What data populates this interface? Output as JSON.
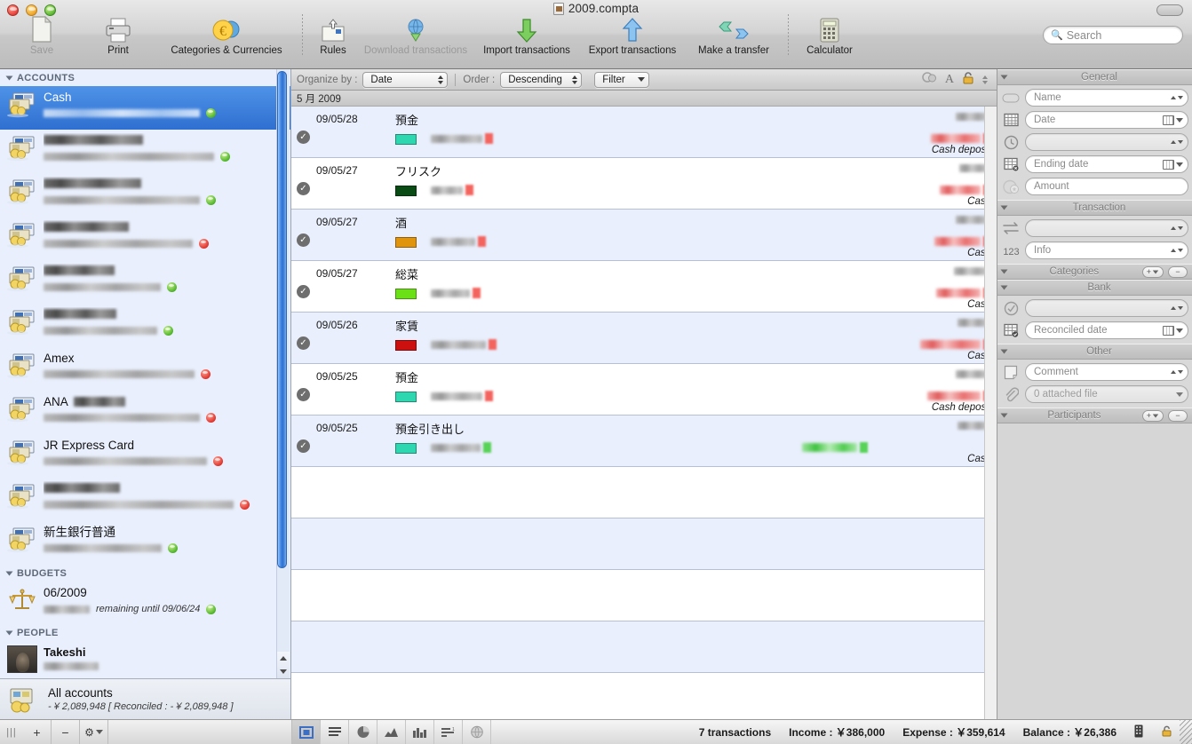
{
  "window": {
    "title": "2009.compta"
  },
  "toolbar": {
    "items": [
      {
        "label": "Save",
        "icon": "document-icon",
        "dim": true
      },
      {
        "label": "Print",
        "icon": "printer-icon",
        "dim": false
      },
      {
        "label": "Categories & Currencies",
        "icon": "euro-coin-icon",
        "dim": false
      },
      {
        "label": "Rules",
        "icon": "rules-icon",
        "dim": false
      },
      {
        "label": "Download transactions",
        "icon": "globe-download-icon",
        "dim": true
      },
      {
        "label": "Import transactions",
        "icon": "green-down-arrow-icon",
        "dim": false
      },
      {
        "label": "Export transactions",
        "icon": "blue-up-arrow-icon",
        "dim": false
      },
      {
        "label": "Make a transfer",
        "icon": "transfer-arrows-icon",
        "dim": false
      },
      {
        "label": "Calculator",
        "icon": "calculator-icon",
        "dim": false
      }
    ],
    "search": {
      "placeholder": "Search",
      "icon": "search-icon"
    }
  },
  "sidebar": {
    "groups": {
      "accounts_label": "ACCOUNTS",
      "budgets_label": "BUDGETS",
      "people_label": "PEOPLE"
    },
    "accounts": [
      {
        "name": "Cash",
        "name_redacted": false,
        "name_blur_w": 0,
        "sub_blur_w": 176,
        "status": "green",
        "selected": true
      },
      {
        "name": "",
        "name_redacted": true,
        "name_blur_w": 112,
        "sub_blur_w": 192,
        "status": "green",
        "selected": false
      },
      {
        "name": "",
        "name_redacted": true,
        "name_blur_w": 110,
        "sub_blur_w": 176,
        "status": "green",
        "selected": false
      },
      {
        "name": "",
        "name_redacted": true,
        "name_blur_w": 96,
        "sub_blur_w": 168,
        "status": "red",
        "selected": false
      },
      {
        "name": "",
        "name_redacted": true,
        "name_blur_w": 80,
        "sub_blur_w": 132,
        "status": "green",
        "selected": false
      },
      {
        "name": "",
        "name_redacted": true,
        "name_blur_w": 82,
        "sub_blur_w": 128,
        "status": "green",
        "selected": false
      },
      {
        "name": "Amex",
        "name_redacted": false,
        "name_blur_w": 0,
        "sub_blur_w": 170,
        "status": "red",
        "selected": false
      },
      {
        "name": "ANA",
        "name_redacted": false,
        "name_blur_w": 58,
        "sub_blur_w": 176,
        "status": "red",
        "selected": false
      },
      {
        "name": "JR Express Card",
        "name_redacted": false,
        "name_blur_w": 0,
        "sub_blur_w": 184,
        "status": "red",
        "selected": false
      },
      {
        "name": "",
        "name_redacted": true,
        "name_blur_w": 86,
        "sub_blur_w": 214,
        "status": "red",
        "selected": false
      },
      {
        "name": "新生銀行普通",
        "name_redacted": false,
        "name_blur_w": 0,
        "sub_blur_w": 133,
        "status": "green",
        "selected": false
      }
    ],
    "budget": {
      "name": "06/2009",
      "remaining_blur_w": 52,
      "sub_text": "remaining until 09/06/24",
      "status": "green",
      "icon": "scales-icon"
    },
    "person": {
      "name": "Takeshi",
      "sub_blur_w": 62,
      "icon": "avatar"
    },
    "footer": {
      "name": "All accounts",
      "sub": "- ¥ 2,089,948 [ Reconciled : - ¥ 2,089,948 ]",
      "icon": "all-accounts-icon"
    },
    "footer_buttons": [
      {
        "icon": "plus-icon",
        "label": "+"
      },
      {
        "icon": "minus-icon",
        "label": "−"
      },
      {
        "icon": "gear-icon",
        "label": "⚙"
      }
    ]
  },
  "transactions_header": {
    "organize_label": "Organize by :",
    "organize_value": "Date",
    "order_label": "Order :",
    "order_value": "Descending",
    "filter_label": "Filter",
    "right_icons": [
      "currency-icon",
      "font-size-icon",
      "lock-icon"
    ]
  },
  "month_group": "5 月 2009",
  "transactions": [
    {
      "date": "09/05/28",
      "category": "預金",
      "color": "#2fd7b0",
      "reconciled": true,
      "mid_blur_w": 58,
      "amt_top_blur_w": 40,
      "amt_mid_blur_w": 56,
      "amt_sign": "red",
      "green_amount": false,
      "account": "Cash deposit",
      "stripe": "even"
    },
    {
      "date": "09/05/27",
      "category": "フリスク",
      "color": "#0a4a14",
      "reconciled": true,
      "mid_blur_w": 36,
      "amt_top_blur_w": 36,
      "amt_mid_blur_w": 46,
      "amt_sign": "red",
      "green_amount": false,
      "account": "Cash",
      "stripe": "odd"
    },
    {
      "date": "09/05/27",
      "category": "酒",
      "color": "#e0940d",
      "reconciled": true,
      "mid_blur_w": 50,
      "amt_top_blur_w": 40,
      "amt_mid_blur_w": 52,
      "amt_sign": "red",
      "green_amount": false,
      "account": "Cash",
      "stripe": "even"
    },
    {
      "date": "09/05/27",
      "category": "総菜",
      "color": "#6ce016",
      "reconciled": true,
      "mid_blur_w": 44,
      "amt_top_blur_w": 42,
      "amt_mid_blur_w": 50,
      "amt_sign": "red",
      "green_amount": false,
      "account": "Cash",
      "stripe": "odd"
    },
    {
      "date": "09/05/26",
      "category": "家賃",
      "color": "#cc1010",
      "reconciled": true,
      "mid_blur_w": 62,
      "amt_top_blur_w": 38,
      "amt_mid_blur_w": 68,
      "amt_sign": "red",
      "green_amount": false,
      "account": "Cash",
      "stripe": "even"
    },
    {
      "date": "09/05/25",
      "category": "預金",
      "color": "#2fd7b0",
      "reconciled": true,
      "mid_blur_w": 58,
      "amt_top_blur_w": 40,
      "amt_mid_blur_w": 60,
      "amt_sign": "red",
      "green_amount": false,
      "account": "Cash deposit",
      "stripe": "odd"
    },
    {
      "date": "09/05/25",
      "category": "預金引き出し",
      "color": "#2fd7b0",
      "reconciled": true,
      "mid_blur_w": 56,
      "amt_top_blur_w": 38,
      "amt_mid_blur_w": 62,
      "amt_sign": "green",
      "green_amount": true,
      "account": "Cash",
      "stripe": "even"
    }
  ],
  "inspector": {
    "sections": [
      {
        "title": "General",
        "buttons": [],
        "fields": [
          {
            "icon": "capsule-icon",
            "placeholder": "Name",
            "control": "stepper",
            "gray": false
          },
          {
            "icon": "calendar-icon",
            "placeholder": "Date",
            "control": "calendar",
            "gray": false
          },
          {
            "icon": "clock-icon",
            "placeholder": "",
            "control": "stepper",
            "gray": true
          },
          {
            "icon": "calendar-end-icon",
            "placeholder": "Ending date",
            "control": "calendar",
            "gray": false
          },
          {
            "icon": "coins-icon",
            "placeholder": "Amount",
            "control": "none",
            "gray": false
          }
        ]
      },
      {
        "title": "Transaction",
        "buttons": [],
        "fields": [
          {
            "icon": "transfer-icon",
            "placeholder": "",
            "control": "stepper",
            "gray": true
          },
          {
            "icon": "numbers-icon",
            "placeholder": "Info",
            "control": "stepper",
            "gray": false
          }
        ]
      },
      {
        "title": "Categories",
        "buttons": [
          "plus-icon",
          "minus-icon"
        ],
        "fields": []
      },
      {
        "title": "Bank",
        "buttons": [],
        "fields": [
          {
            "icon": "check-circle-icon",
            "placeholder": "",
            "control": "stepper",
            "gray": true
          },
          {
            "icon": "calendar-check-icon",
            "placeholder": "Reconciled date",
            "control": "calendar",
            "gray": false
          }
        ]
      },
      {
        "title": "Other",
        "buttons": [],
        "fields": [
          {
            "icon": "note-icon",
            "placeholder": "Comment",
            "control": "stepper",
            "gray": false
          },
          {
            "icon": "paperclip-icon",
            "placeholder": "0 attached file",
            "control": "dropdown",
            "gray": true
          }
        ]
      },
      {
        "title": "Participants",
        "buttons": [
          "plus-icon",
          "minus-icon"
        ],
        "fields": []
      }
    ]
  },
  "bottom_bar": {
    "left_buttons": [
      {
        "icon": "grip-icon",
        "label": "|||"
      },
      {
        "icon": "plus-icon",
        "label": "+"
      },
      {
        "icon": "minus-icon",
        "label": "−"
      },
      {
        "icon": "gear-icon",
        "label": "⚙"
      }
    ],
    "view_icons": [
      {
        "icon": "panel-view-icon",
        "selected": true
      },
      {
        "icon": "list-view-icon",
        "selected": false
      },
      {
        "icon": "pie-chart-icon",
        "selected": false
      },
      {
        "icon": "area-chart-icon",
        "selected": false
      },
      {
        "icon": "bar-chart-icon",
        "selected": false
      },
      {
        "icon": "ranked-list-icon",
        "selected": false
      },
      {
        "icon": "globe-icon",
        "selected": false
      }
    ],
    "status": {
      "transactions": "7 transactions",
      "income": "Income : ￥386,000",
      "expense": "Expense : ￥359,614",
      "balance": "Balance : ￥26,386"
    },
    "status_icons": [
      "keypad-icon",
      "lock-icon"
    ]
  }
}
